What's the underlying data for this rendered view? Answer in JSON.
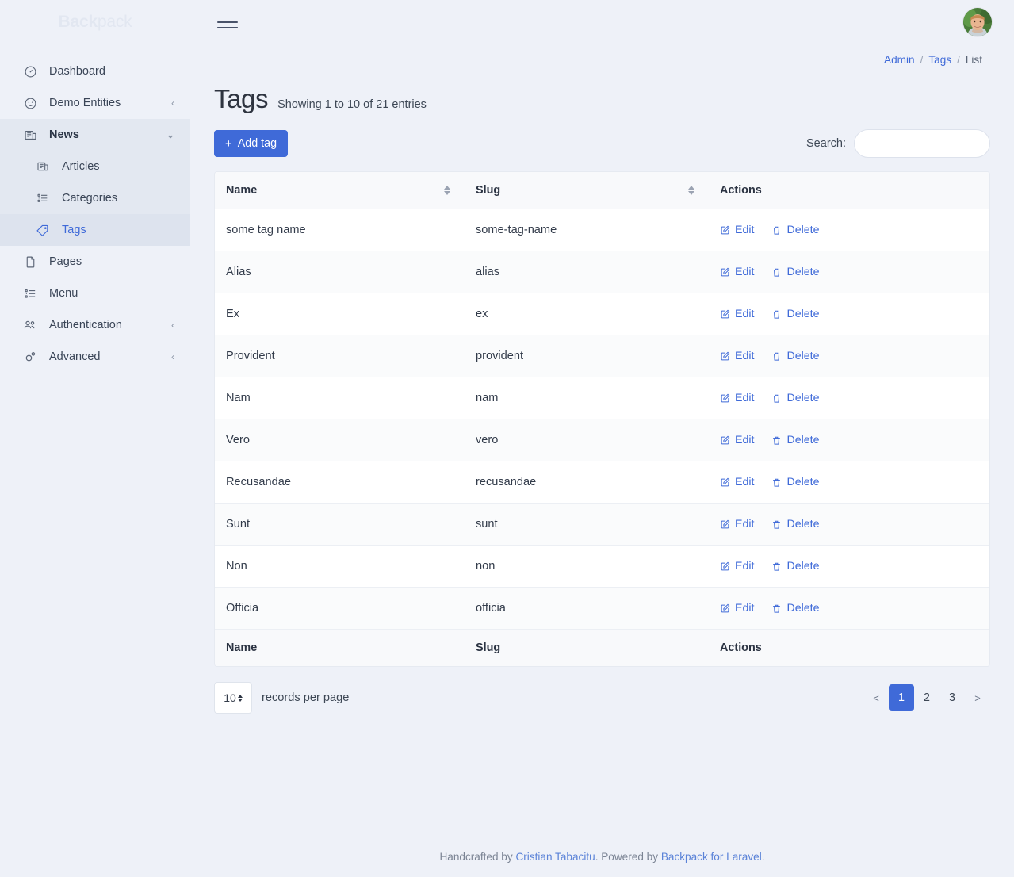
{
  "brand": {
    "bold": "Back",
    "light": "pack"
  },
  "sidebar": {
    "items": [
      {
        "label": "Dashboard",
        "icon": "speedometer-icon",
        "caret": ""
      },
      {
        "label": "Demo Entities",
        "icon": "smiley-icon",
        "caret": "‹"
      },
      {
        "label": "News",
        "icon": "newspaper-icon",
        "caret": "⌄"
      }
    ],
    "news_children": [
      {
        "label": "Articles",
        "icon": "newspaper-icon"
      },
      {
        "label": "Categories",
        "icon": "list-icon"
      },
      {
        "label": "Tags",
        "icon": "tag-icon"
      }
    ],
    "items_after": [
      {
        "label": "Pages",
        "icon": "file-icon",
        "caret": ""
      },
      {
        "label": "Menu",
        "icon": "list-icon",
        "caret": ""
      },
      {
        "label": "Authentication",
        "icon": "users-icon",
        "caret": "‹"
      },
      {
        "label": "Advanced",
        "icon": "gear-icon",
        "caret": "‹"
      }
    ]
  },
  "breadcrumb": {
    "admin": "Admin",
    "sep1": "/",
    "tags": "Tags",
    "sep2": "/",
    "list": "List"
  },
  "page": {
    "title": "Tags",
    "subtitle": "Showing 1 to 10 of 21 entries"
  },
  "toolbar": {
    "add_plus": "+",
    "add_label": "Add tag",
    "search_label": "Search:",
    "search_value": "",
    "search_placeholder": ""
  },
  "table": {
    "columns": [
      "Name",
      "Slug",
      "Actions"
    ],
    "rows": [
      {
        "name": "some tag name",
        "slug": "some-tag-name",
        "edit": "Edit",
        "delete": "Delete"
      },
      {
        "name": "Alias",
        "slug": "alias",
        "edit": "Edit",
        "delete": "Delete"
      },
      {
        "name": "Ex",
        "slug": "ex",
        "edit": "Edit",
        "delete": "Delete"
      },
      {
        "name": "Provident",
        "slug": "provident",
        "edit": "Edit",
        "delete": "Delete"
      },
      {
        "name": "Nam",
        "slug": "nam",
        "edit": "Edit",
        "delete": "Delete"
      },
      {
        "name": "Vero",
        "slug": "vero",
        "edit": "Edit",
        "delete": "Delete"
      },
      {
        "name": "Recusandae",
        "slug": "recusandae",
        "edit": "Edit",
        "delete": "Delete"
      },
      {
        "name": "Sunt",
        "slug": "sunt",
        "edit": "Edit",
        "delete": "Delete"
      },
      {
        "name": "Non",
        "slug": "non",
        "edit": "Edit",
        "delete": "Delete"
      },
      {
        "name": "Officia",
        "slug": "officia",
        "edit": "Edit",
        "delete": "Delete"
      }
    ]
  },
  "pagination": {
    "per_page_value": "10",
    "per_page_label": "records per page",
    "prev": "<",
    "pages": [
      "1",
      "2",
      "3"
    ],
    "active_page": "1",
    "next": ">"
  },
  "footer": {
    "prefix": "Handcrafted by ",
    "author": "Cristian Tabacitu",
    "middle": ". Powered by ",
    "product": "Backpack for Laravel",
    "suffix": "."
  },
  "colors": {
    "accent": "#3f6ad8",
    "page_bg": "#eef1f8",
    "card_bg": "#ffffff",
    "row_alt": "#fafbfc",
    "head_bg": "#f8f9fb"
  }
}
